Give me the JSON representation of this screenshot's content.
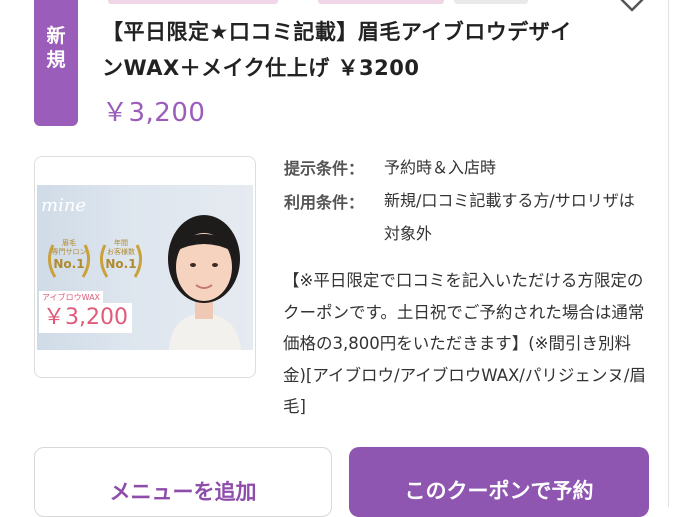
{
  "badge": {
    "line1": "新",
    "line2": "規"
  },
  "coupon": {
    "title": "【平日限定★口コミ記載】眉毛アイブロウデザインWAX＋メイク仕上げ ￥3200",
    "price": "￥3,200"
  },
  "thumbnail": {
    "brand": "mine",
    "award1_top": "眉毛",
    "award1_mid": "専門サロン",
    "award1_no": "No.1",
    "award2_top": "年間",
    "award2_mid": "お客様数",
    "award2_no": "No.1",
    "promo_tag": "アイブロウWAX",
    "promo_price": "￥3,200"
  },
  "conditions": {
    "present_label": "提示条件：",
    "present_value": "予約時＆入店時",
    "usage_label": "利用条件：",
    "usage_value": "新規/口コミ記載する方/サロリザは対象外"
  },
  "description": "【※平日限定で口コミを記入いただける方限定のクーポンです。土日祝でご予約された場合は通常価格の3,800円をいただきます】(※間引き別料金)[アイブロウ/アイブロウWAX/パリジェンヌ/眉毛]",
  "buttons": {
    "add_menu": "メニューを追加",
    "reserve": "このクーポンで予約"
  },
  "colors": {
    "accent": "#9b5dba",
    "button": "#8e55b1",
    "promo": "#e05a7a"
  },
  "icons": {
    "favorite": "heart-outline-icon"
  }
}
